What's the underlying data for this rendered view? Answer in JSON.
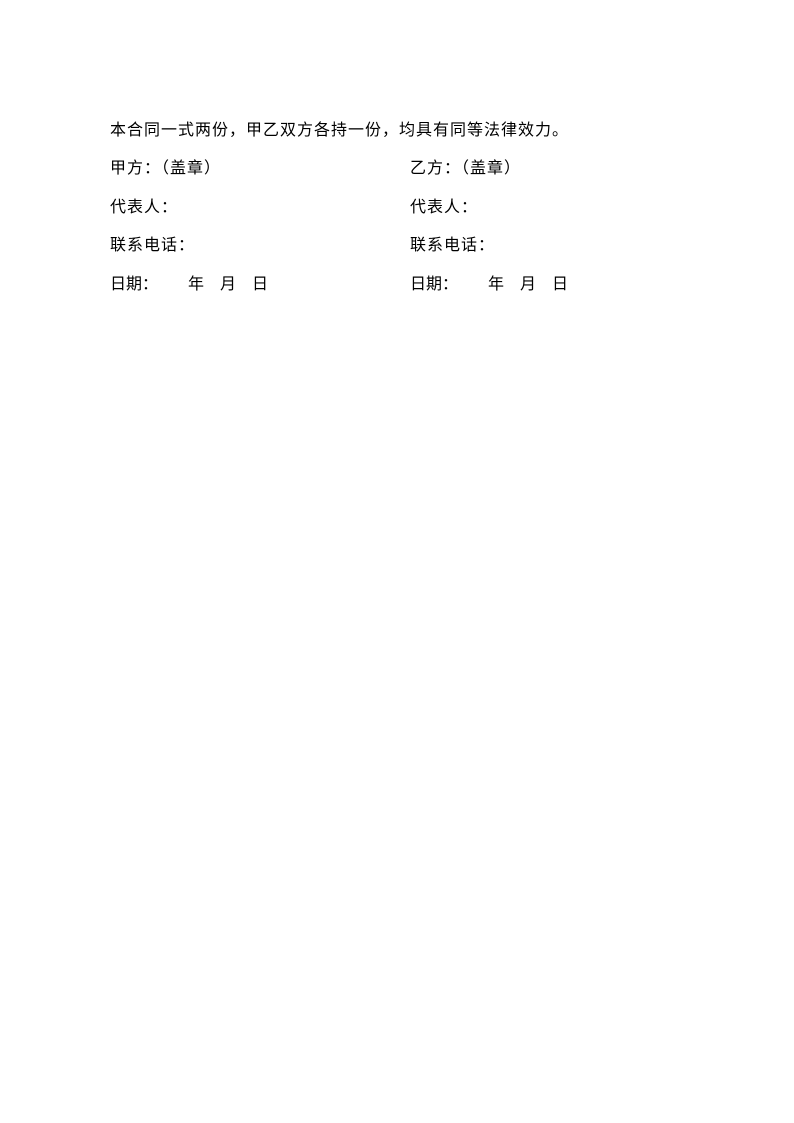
{
  "intro": "本合同一式两份，甲乙双方各持一份，均具有同等法律效力。",
  "partyA": {
    "seal": "甲方：（盖章）",
    "representative": "代表人：",
    "phone": "联系电话：",
    "date_label": "日期：",
    "year": "年",
    "month": "月",
    "day": "日"
  },
  "partyB": {
    "seal": "乙方：（盖章）",
    "representative": "代表人：",
    "phone": "联系电话：",
    "date_label": "日期：",
    "year": "年",
    "month": "月",
    "day": "日"
  }
}
